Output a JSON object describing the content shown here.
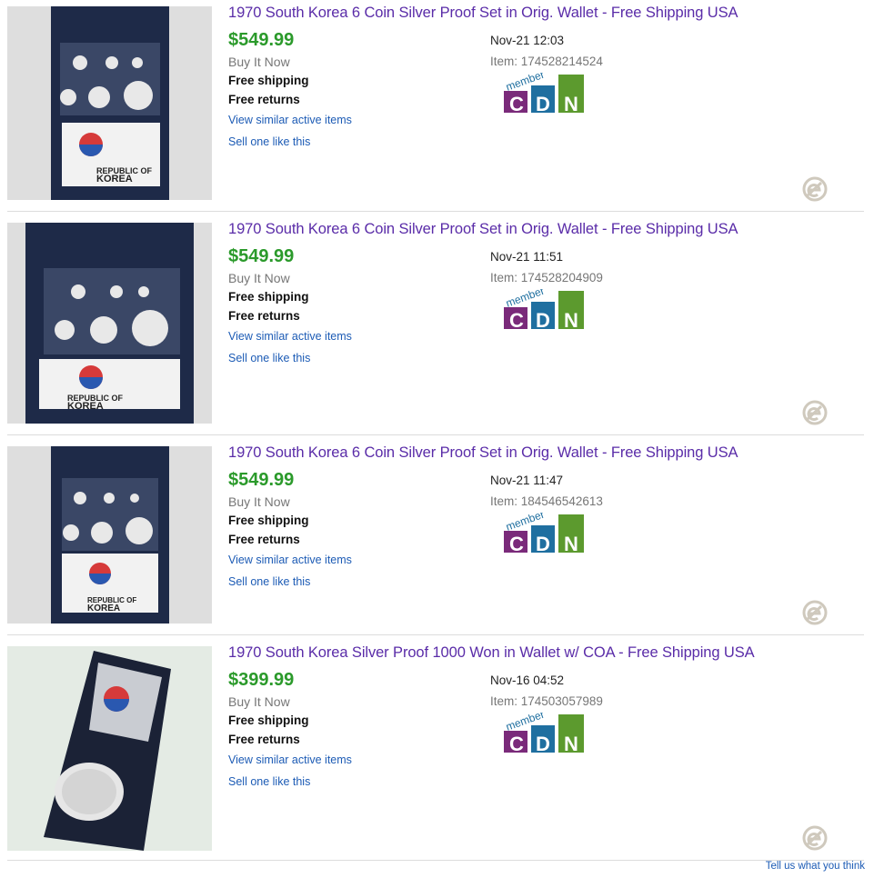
{
  "listings": [
    {
      "title": "1970 South Korea 6 Coin Silver Proof Set in Orig. Wallet - Free Shipping USA",
      "price": "$549.99",
      "format": "Buy It Now",
      "shipping": "Free shipping",
      "returns": "Free returns",
      "similar_link": "View similar active items",
      "sell_link": "Sell one like this",
      "date": "Nov-21 12:03",
      "item_number": "Item: 174528214524",
      "badge": {
        "top": "member",
        "letters": [
          "C",
          "D",
          "N"
        ]
      }
    },
    {
      "title": "1970 South Korea 6 Coin Silver Proof Set in Orig. Wallet - Free Shipping USA",
      "price": "$549.99",
      "format": "Buy It Now",
      "shipping": "Free shipping",
      "returns": "Free returns",
      "similar_link": "View similar active items",
      "sell_link": "Sell one like this",
      "date": "Nov-21 11:51",
      "item_number": "Item: 174528204909",
      "badge": {
        "top": "member",
        "letters": [
          "C",
          "D",
          "N"
        ]
      }
    },
    {
      "title": "1970 South Korea 6 Coin Silver Proof Set in Orig. Wallet - Free Shipping USA",
      "price": "$549.99",
      "format": "Buy It Now",
      "shipping": "Free shipping",
      "returns": "Free returns",
      "similar_link": "View similar active items",
      "sell_link": "Sell one like this",
      "date": "Nov-21 11:47",
      "item_number": "Item: 184546542613",
      "badge": {
        "top": "member",
        "letters": [
          "C",
          "D",
          "N"
        ]
      }
    },
    {
      "title": "1970 South Korea Silver Proof 1000 Won in Wallet w/ COA - Free Shipping USA",
      "price": "$399.99",
      "format": "Buy It Now",
      "shipping": "Free shipping",
      "returns": "Free returns",
      "similar_link": "View similar active items",
      "sell_link": "Sell one like this",
      "date": "Nov-16 04:52",
      "item_number": "Item: 174503057989",
      "badge": {
        "top": "member",
        "letters": [
          "C",
          "D",
          "N"
        ]
      }
    }
  ],
  "thumb_text": {
    "country_line1": "REPUBLIC OF",
    "country_line2": "KOREA"
  },
  "icons": {
    "ended": "ebay-e-icon"
  },
  "colors": {
    "title": "#5a2ca8",
    "price": "#2b9a2b",
    "link": "#1c5bb5",
    "badge_c": "#7a2a7a",
    "badge_d": "#1f6fa0",
    "badge_n": "#5c9a2e"
  },
  "footer": {
    "feedback_link": "Tell us what you think"
  }
}
